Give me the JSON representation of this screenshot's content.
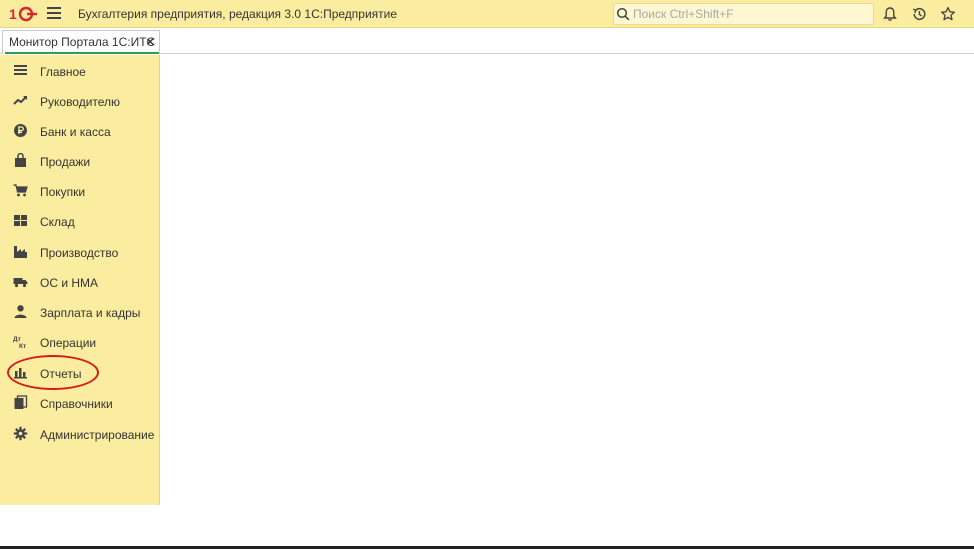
{
  "app": {
    "title": "Бухгалтерия предприятия, редакция 3.0 1С:Предприятие",
    "search_placeholder": "Поиск Ctrl+Shift+F"
  },
  "icons": {
    "logo": "1c-logo-icon",
    "menu": "hamburger-icon",
    "search": "search-icon",
    "notifications": "bell-icon",
    "history": "history-icon",
    "favorites": "star-icon"
  },
  "tabs": [
    {
      "label": "Монитор Портала 1С:ИТС",
      "close": "×"
    }
  ],
  "sidebar": {
    "items": [
      {
        "label": "Главное",
        "icon": "list-icon"
      },
      {
        "label": "Руководителю",
        "icon": "trend-icon"
      },
      {
        "label": "Банк и касса",
        "icon": "ruble-icon"
      },
      {
        "label": "Продажи",
        "icon": "bag-icon"
      },
      {
        "label": "Покупки",
        "icon": "cart-icon"
      },
      {
        "label": "Склад",
        "icon": "warehouse-icon"
      },
      {
        "label": "Производство",
        "icon": "factory-icon"
      },
      {
        "label": "ОС и НМА",
        "icon": "truck-icon"
      },
      {
        "label": "Зарплата и кадры",
        "icon": "person-icon"
      },
      {
        "label": "Операции",
        "icon": "dt-kt-icon"
      },
      {
        "label": "Отчеты",
        "icon": "bar-chart-icon"
      },
      {
        "label": "Справочники",
        "icon": "books-icon"
      },
      {
        "label": "Администрирование",
        "icon": "gear-icon"
      }
    ]
  },
  "colors": {
    "panel": "#fbeda0",
    "accent_tab": "#2f9e56",
    "highlight": "#d41c1c"
  }
}
